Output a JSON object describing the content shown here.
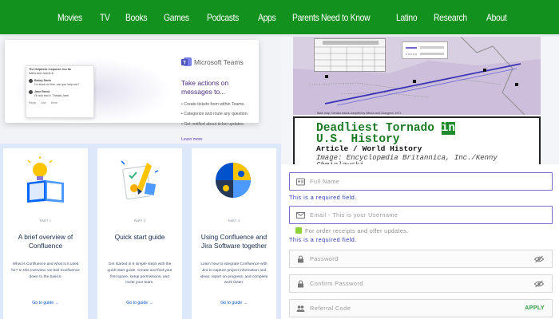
{
  "nav": {
    "items": [
      "Movies",
      "TV",
      "Books",
      "Games",
      "Podcasts",
      "Apps",
      "Parents Need to Know",
      "Latino",
      "Research",
      "About"
    ],
    "bg_color": "#13911f"
  },
  "teams_promo": {
    "brand": "Microsoft Teams",
    "headline": "Take actions on messages to...",
    "bullets": [
      "Create tickets from within Teams.",
      "Categorize and route any question.",
      "Get notified about ticket updates."
    ],
    "link": "Learn more",
    "chat_preview": {
      "title": "The Helpdesk response Jun 8a",
      "subtitle": "Sales and Jolene in",
      "messages": [
        {
          "name": "Bailey Davis",
          "text": "I'm stuck on this, can you help me?"
        },
        {
          "name": "Jane Brock",
          "text": "I'll look into it. Thanks Jane."
        }
      ],
      "actions": [
        "Reply",
        "Like",
        "More"
      ]
    }
  },
  "confluence_guides": [
    {
      "part": "PART 1",
      "title": "A brief overview of Confluence",
      "desc": "What is Confluence and what is it used for? In this overview, we boil Confluence down to the basics.",
      "link": "Go to guide →",
      "icon": "book-lightbulb-icon"
    },
    {
      "part": "PART 2",
      "title": "Quick start guide",
      "desc": "Get started in 6 simple steps with the quick start guide. Create and find your first space, setup permissions, and invite your team.",
      "link": "Go to guide →",
      "icon": "pencil-paper-icon"
    },
    {
      "part": "PART 3",
      "title": "Using Confluence and Jira Software together",
      "desc": "Learn how to integrate Confluence with Jira to capture project information and ideas, report on progress, and complete work faster.",
      "link": "Go to guide →",
      "icon": "puzzle-globe-icon"
    }
  ],
  "tornado_article": {
    "title_line1_pre": "Deadliest Tornado ",
    "title_line1_hl": "in",
    "title_line2": "U.S. History",
    "subtitle": "Article / World History",
    "image_credit": "Image: Encyclopædia Britannica, Inc./Kenny Chmielewski",
    "map_caption": "Base map: Tornado tracks compiled by Wilson and Changnon, 1971"
  },
  "signup_form": {
    "full_name_placeholder": "Full Name",
    "full_name_error": "This is a required field.",
    "email_placeholder": "Email - This is your Username",
    "checkbox_label": "For order receipts and offer updates.",
    "email_error": "This is a required field.",
    "password_placeholder": "Password",
    "confirm_password_placeholder": "Confirm Password",
    "referral_placeholder": "Referral Code",
    "apply_label": "APPLY",
    "checkbox_color": "#8fd13b",
    "error_color": "#2e3bb2",
    "apply_color": "#2a9a3a"
  }
}
